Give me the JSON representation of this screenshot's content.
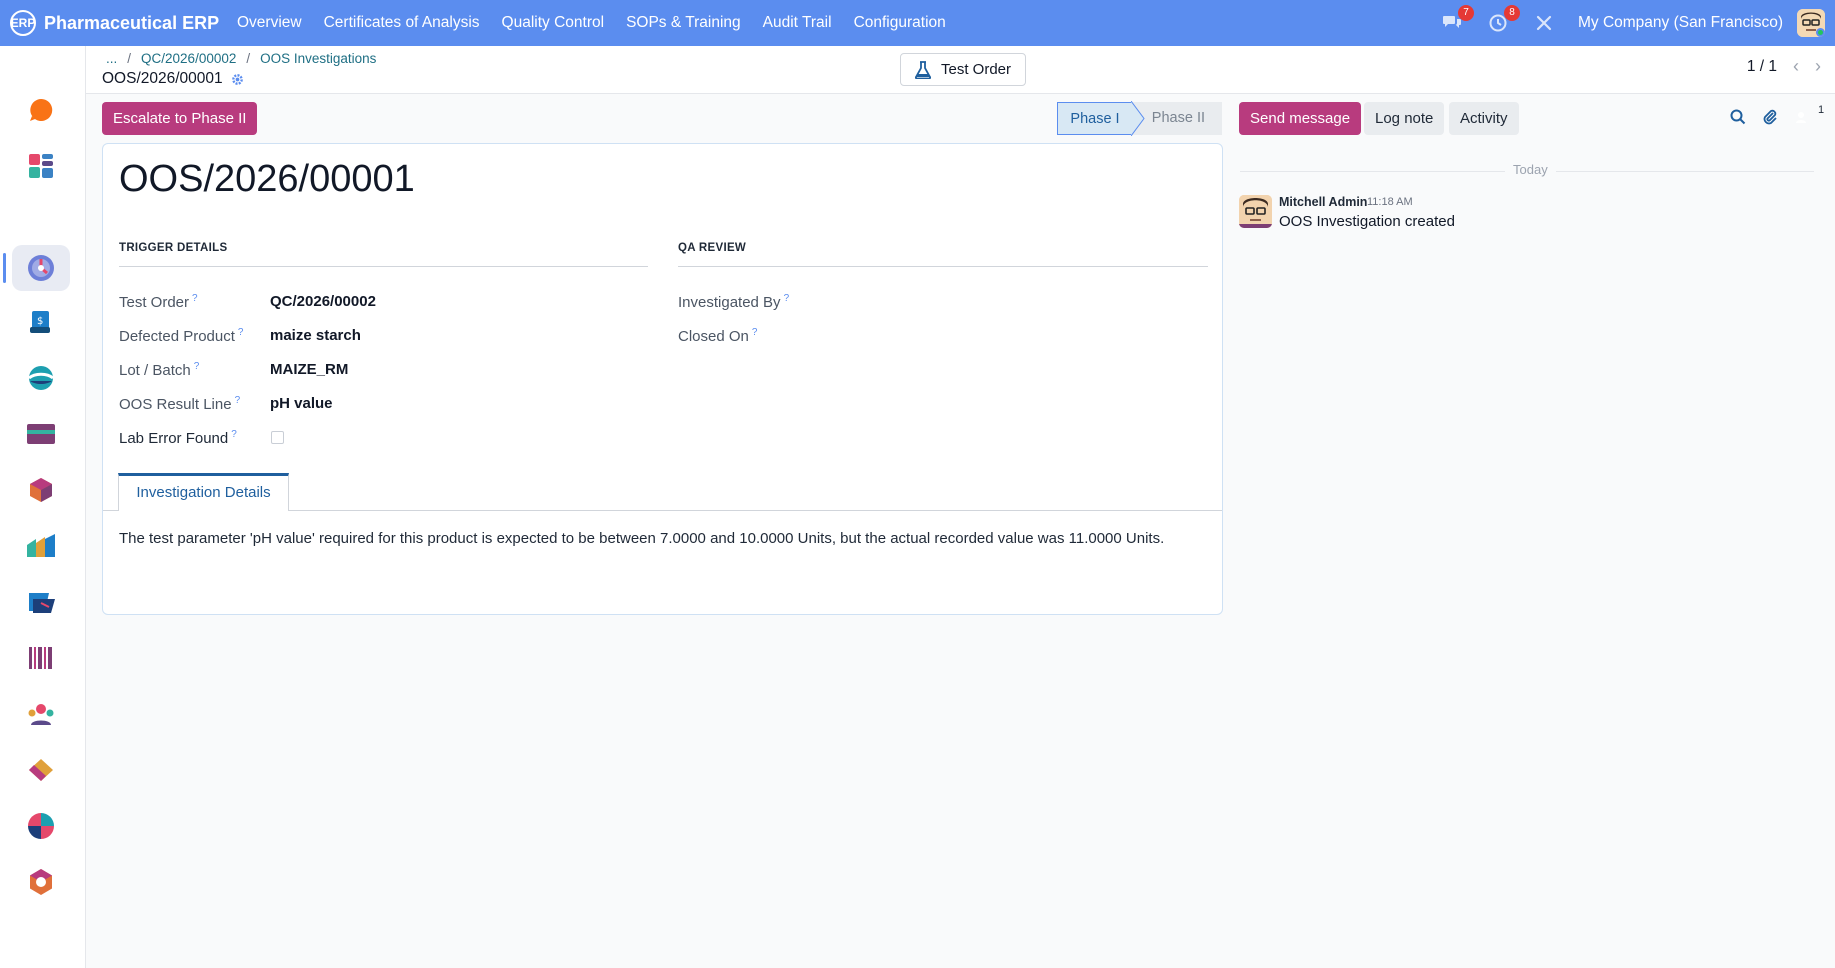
{
  "app": {
    "brand_logo": "ERP",
    "name": "Pharmaceutical ERP",
    "nav": [
      "Overview",
      "Certificates of Analysis",
      "Quality Control",
      "SOPs & Training",
      "Audit Trail",
      "Configuration"
    ],
    "messages_badge": "7",
    "activities_badge": "8",
    "company": "My Company (San Francisco)"
  },
  "breadcrumb": {
    "ellipsis": "...",
    "sep": "/",
    "items": [
      "QC/2026/00002",
      "OOS Investigations"
    ],
    "current": "OOS/2026/00001"
  },
  "smart_button": {
    "label": "Test Order",
    "icon": "flask-icon"
  },
  "pager": {
    "value": "1 / 1",
    "prev": "‹",
    "next": "›"
  },
  "actions": {
    "escalate_label": "Escalate to Phase II"
  },
  "statusbar": {
    "phases": [
      "Phase I",
      "Phase II"
    ],
    "active": "Phase I"
  },
  "form": {
    "title": "OOS/2026/00001",
    "trigger_details": {
      "heading": "TRIGGER DETAILS",
      "fields": [
        {
          "label": "Test Order",
          "value": "QC/2026/00002"
        },
        {
          "label": "Defected Product",
          "value": "maize starch"
        },
        {
          "label": "Lot / Batch",
          "value": "MAIZE_RM"
        },
        {
          "label": "OOS Result Line",
          "value": "pH value"
        },
        {
          "label": "Lab Error Found",
          "value": ""
        }
      ]
    },
    "qa_review": {
      "heading": "QA REVIEW",
      "fields": [
        {
          "label": "Investigated By",
          "value": ""
        },
        {
          "label": "Closed On",
          "value": ""
        }
      ]
    },
    "help_mark": "?",
    "tab_label": "Investigation Details",
    "description": "The test parameter 'pH value' required for this product is expected to be between 7.0000 and 10.0000 Units, but the actual recorded value was 11.0000 Units."
  },
  "chatter": {
    "send_message": "Send message",
    "log_note": "Log note",
    "activity": "Activity",
    "follower_count": "1",
    "day_label": "Today",
    "messages": [
      {
        "author": "Mitchell Admin",
        "time": "11:18 AM",
        "body": "OOS Investigation created"
      }
    ]
  },
  "colors": {
    "navbar": "#5b8def",
    "primary_button": "#b83b7e",
    "link": "#1f6f84"
  }
}
